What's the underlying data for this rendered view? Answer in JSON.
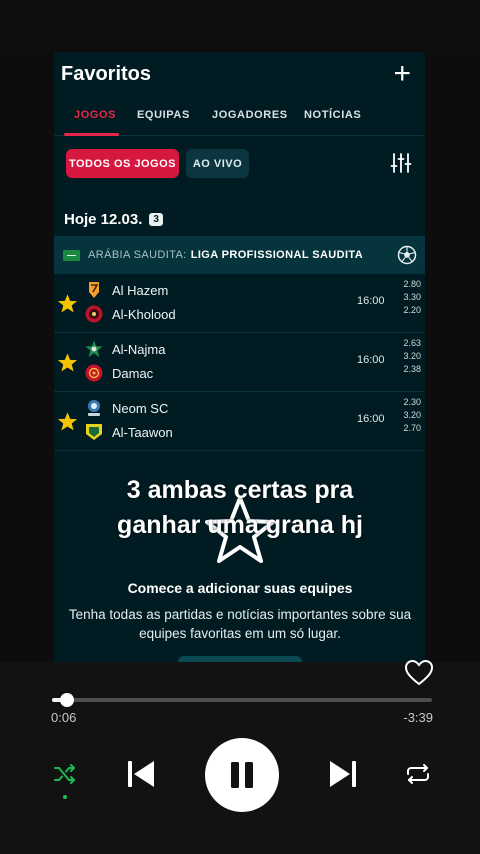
{
  "app": {
    "title": "Favoritos",
    "tabs": [
      {
        "label": "JOGOS",
        "active": true
      },
      {
        "label": "EQUIPAS",
        "active": false
      },
      {
        "label": "JOGADORES",
        "active": false
      },
      {
        "label": "NOTÍCIAS",
        "active": false
      }
    ],
    "filters": {
      "all_label": "TODOS OS JOGOS",
      "live_label": "AO VIVO"
    },
    "date": {
      "label": "Hoje 12.03.",
      "count": "3"
    },
    "league": {
      "country": "ARÁBIA SAUDITA:",
      "name": "LIGA PROFISSIONAL SAUDITA"
    },
    "matches": [
      {
        "home": "Al Hazem",
        "away": "Al-Kholood",
        "time": "16:00",
        "odds": [
          "2.80",
          "3.30",
          "2.20"
        ]
      },
      {
        "home": "Al-Najma",
        "away": "Damac",
        "time": "16:00",
        "odds": [
          "2.63",
          "3.20",
          "2.38"
        ]
      },
      {
        "home": "Neom SC",
        "away": "Al-Taawon",
        "time": "16:00",
        "odds": [
          "2.30",
          "3.20",
          "2.70"
        ]
      }
    ],
    "empty_state": {
      "title": "Comece a adicionar suas equipes",
      "desc_line1": "Tenha todas as partidas e notícias importantes sobre sua",
      "desc_line2": "equipes favoritas em um só lugar."
    }
  },
  "overlay": {
    "line1": "3 ambas certas pra",
    "line2": "ganhar uma grana hj"
  },
  "player": {
    "elapsed": "0:06",
    "remaining": "-3:39",
    "progress_fraction": 0.04
  },
  "colors": {
    "accent": "#e8264a",
    "app_bg": "#001c22",
    "league_bg": "#05343d",
    "star": "#f5c400",
    "shuffle_active": "#1db954"
  }
}
